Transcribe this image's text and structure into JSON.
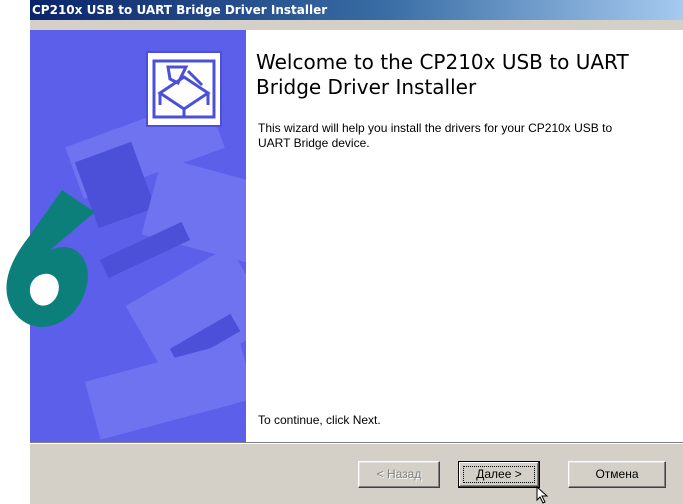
{
  "window": {
    "title": "CP210x USB to UART Bridge Driver Installer"
  },
  "content": {
    "headline": "Welcome to the CP210x USB to UART Bridge Driver Installer",
    "description": "This wizard will help you install the drivers for your CP210x USB to UART Bridge device.",
    "continue_text": "To continue, click Next."
  },
  "buttons": {
    "back": "< Назад",
    "next": "Далее >",
    "cancel": "Отмена"
  },
  "colors": {
    "banner": "#5b5fe9",
    "title_bar": "#0a246a",
    "logo": "#0d7f7b"
  },
  "icons": {
    "installer": "installer-box-icon",
    "logo": "logo-icon",
    "cursor": "mouse-cursor-icon"
  }
}
